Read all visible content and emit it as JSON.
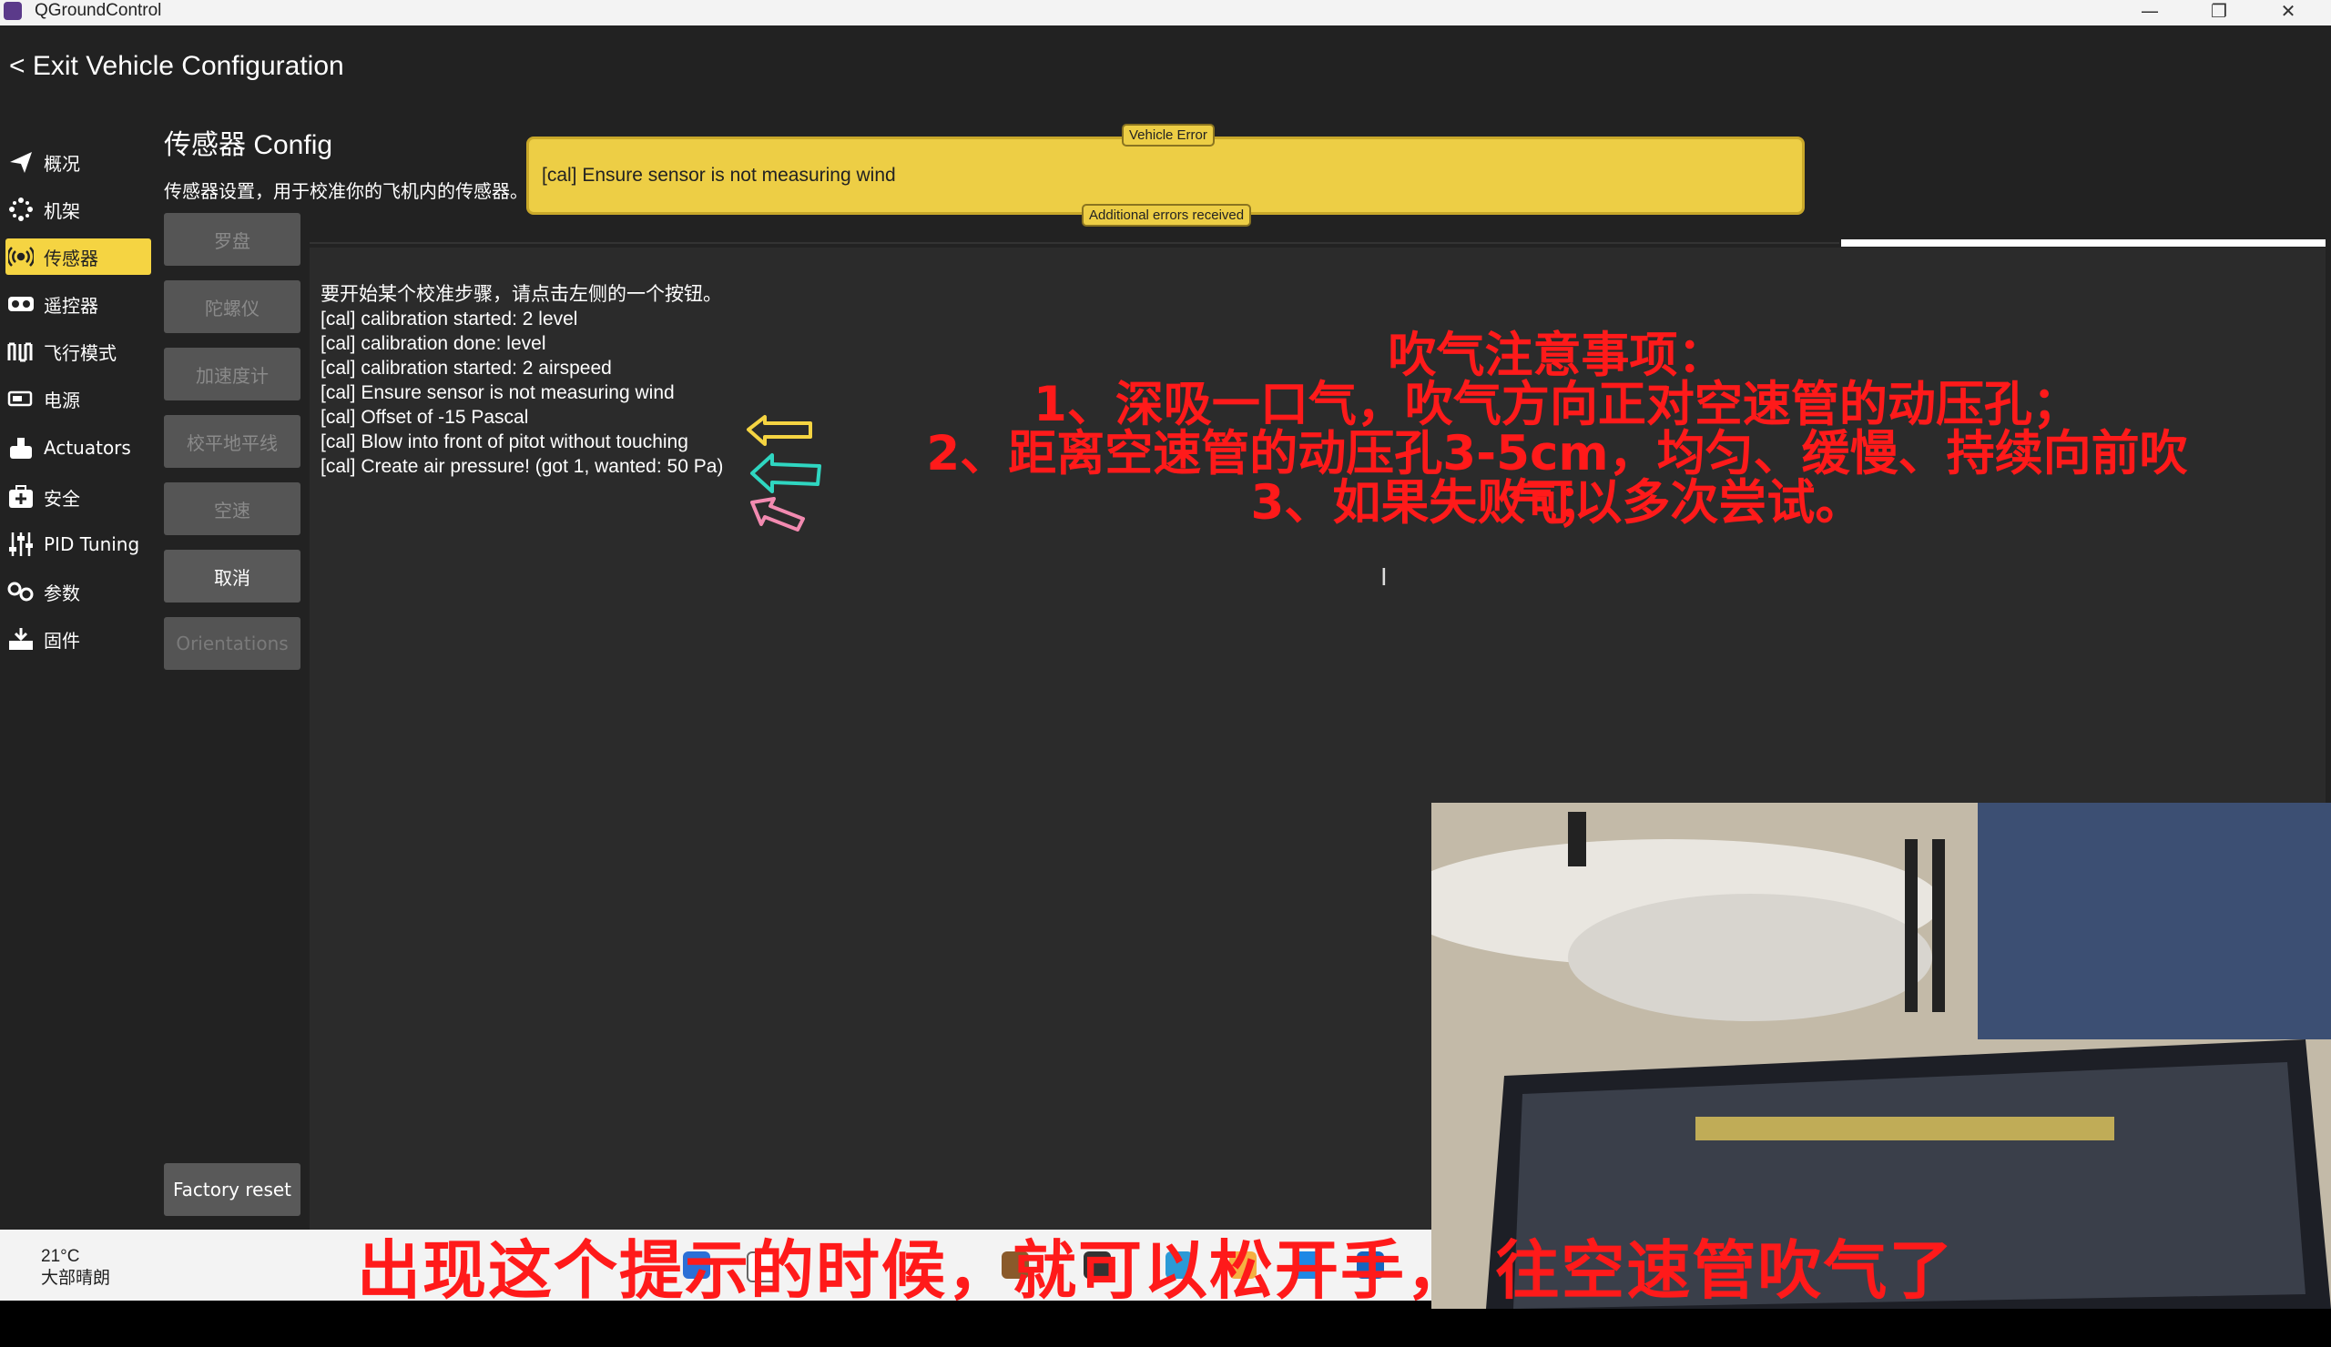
{
  "window": {
    "title": "QGroundControl",
    "minimize": "—",
    "restore": "❐",
    "close": "✕"
  },
  "header": {
    "exit_label": "< Exit Vehicle Configuration"
  },
  "sidebar": {
    "items": [
      {
        "label": "概况",
        "icon": "paper-plane-icon"
      },
      {
        "label": "机架",
        "icon": "airframe-icon"
      },
      {
        "label": "传感器",
        "icon": "sensors-icon",
        "active": true
      },
      {
        "label": "遥控器",
        "icon": "radio-icon"
      },
      {
        "label": "飞行模式",
        "icon": "flight-modes-icon"
      },
      {
        "label": "电源",
        "icon": "battery-icon"
      },
      {
        "label": "Actuators",
        "icon": "actuators-icon"
      },
      {
        "label": "安全",
        "icon": "safety-icon"
      },
      {
        "label": "PID Tuning",
        "icon": "pid-tuning-icon"
      },
      {
        "label": "参数",
        "icon": "parameters-icon"
      },
      {
        "label": "固件",
        "icon": "firmware-icon"
      }
    ]
  },
  "page": {
    "title": "传感器 Config",
    "description": "传感器设置，用于校准你的飞机内的传感器。"
  },
  "sensor_buttons": [
    {
      "label": "罗盘",
      "state": "disabled"
    },
    {
      "label": "陀螺仪",
      "state": "disabled"
    },
    {
      "label": "加速度计",
      "state": "disabled"
    },
    {
      "label": "校平地平线",
      "state": "disabled"
    },
    {
      "label": "空速",
      "state": "disabled"
    },
    {
      "label": "取消",
      "state": "enabled"
    },
    {
      "label": "Orientations",
      "state": "faded"
    }
  ],
  "factory_reset_label": "Factory reset",
  "error": {
    "tag": "Vehicle Error",
    "message": "[cal] Ensure sensor is not measuring wind",
    "footer": "Additional errors received"
  },
  "log": [
    "要开始某个校准步骤，请点击左侧的一个按钮。",
    "[cal] calibration started: 2 level",
    "[cal] calibration done: level",
    "[cal] calibration started: 2 airspeed",
    "[cal] Ensure sensor is not measuring wind",
    "[cal] Offset of -15 Pascal",
    "[cal] Blow into front of pitot without touching",
    "[cal] Create air pressure! (got 1, wanted: 50 Pa)"
  ],
  "annotation": [
    "吹气注意事项：",
    "1、深吸一口气，吹气方向正对空速管的动压孔；",
    "2、距离空速管的动压孔3-5cm，均匀、缓慢、持续向前吹气；",
    "3、如果失败可以多次尝试。"
  ],
  "taskbar": {
    "temperature": "21°C",
    "weather": "大部晴朗"
  },
  "subtitle": "出现这个提示的时候，就可以松开手， 往空速管吹气了",
  "colors": {
    "accent": "#f5d442",
    "error_bg": "#edce45",
    "annotation": "#ff1a1a",
    "panel": "#2b2b2b"
  }
}
